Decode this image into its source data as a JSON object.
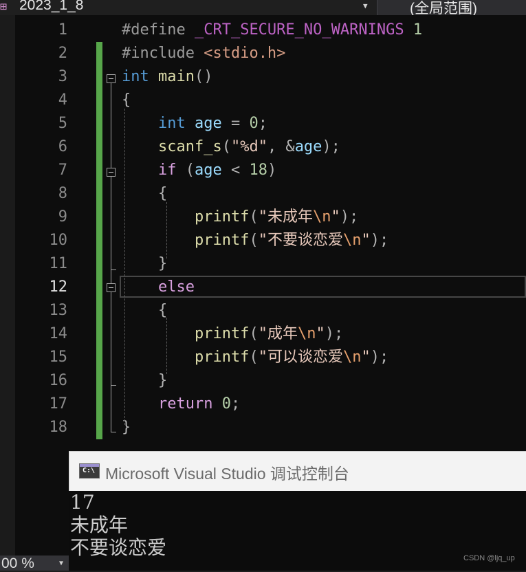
{
  "toolbar": {
    "project_name": "2023_1_8",
    "scope": "(全局范围)",
    "icons": {
      "project": "project-icon",
      "dropdown": "chevron-down-icon"
    }
  },
  "editor": {
    "line_numbers": [
      "1",
      "2",
      "3",
      "4",
      "5",
      "6",
      "7",
      "8",
      "9",
      "10",
      "11",
      "12",
      "13",
      "14",
      "15",
      "16",
      "17",
      "18"
    ],
    "current_line": "12",
    "lines": [
      [
        {
          "t": "#define ",
          "c": "pre"
        },
        {
          "t": "_CRT_SECURE_NO_WARNINGS",
          "c": "macro"
        },
        {
          "t": " ",
          "c": "op"
        },
        {
          "t": "1",
          "c": "num"
        }
      ],
      [
        {
          "t": "#include ",
          "c": "pre"
        },
        {
          "t": "<stdio.h>",
          "c": "inc"
        }
      ],
      [
        {
          "t": "int",
          "c": "kw"
        },
        {
          "t": " ",
          "c": "op"
        },
        {
          "t": "main",
          "c": "fn"
        },
        {
          "t": "()",
          "c": "op"
        }
      ],
      [
        {
          "t": "{",
          "c": "op"
        }
      ],
      [
        {
          "t": "    ",
          "c": "op"
        },
        {
          "t": "int",
          "c": "kw"
        },
        {
          "t": " ",
          "c": "op"
        },
        {
          "t": "age",
          "c": "var"
        },
        {
          "t": " = ",
          "c": "op"
        },
        {
          "t": "0",
          "c": "num"
        },
        {
          "t": ";",
          "c": "op"
        }
      ],
      [
        {
          "t": "    ",
          "c": "op"
        },
        {
          "t": "scanf_s",
          "c": "fn"
        },
        {
          "t": "(",
          "c": "op"
        },
        {
          "t": "\"%d\"",
          "c": "str"
        },
        {
          "t": ", &",
          "c": "op"
        },
        {
          "t": "age",
          "c": "var"
        },
        {
          "t": ");",
          "c": "op"
        }
      ],
      [
        {
          "t": "    ",
          "c": "op"
        },
        {
          "t": "if",
          "c": "ctrl"
        },
        {
          "t": " (",
          "c": "op"
        },
        {
          "t": "age",
          "c": "var"
        },
        {
          "t": " < ",
          "c": "op"
        },
        {
          "t": "18",
          "c": "num"
        },
        {
          "t": ")",
          "c": "op"
        }
      ],
      [
        {
          "t": "    {",
          "c": "op"
        }
      ],
      [
        {
          "t": "        ",
          "c": "op"
        },
        {
          "t": "printf",
          "c": "fn"
        },
        {
          "t": "(",
          "c": "op"
        },
        {
          "t": "\"未成年",
          "c": "str"
        },
        {
          "t": "\\n",
          "c": "esc"
        },
        {
          "t": "\"",
          "c": "str"
        },
        {
          "t": ");",
          "c": "op"
        }
      ],
      [
        {
          "t": "        ",
          "c": "op"
        },
        {
          "t": "printf",
          "c": "fn"
        },
        {
          "t": "(",
          "c": "op"
        },
        {
          "t": "\"不要谈恋爱",
          "c": "str"
        },
        {
          "t": "\\n",
          "c": "esc"
        },
        {
          "t": "\"",
          "c": "str"
        },
        {
          "t": ");",
          "c": "op"
        }
      ],
      [
        {
          "t": "    }",
          "c": "op"
        }
      ],
      [
        {
          "t": "    ",
          "c": "op"
        },
        {
          "t": "else",
          "c": "ctrl"
        }
      ],
      [
        {
          "t": "    {",
          "c": "op"
        }
      ],
      [
        {
          "t": "        ",
          "c": "op"
        },
        {
          "t": "printf",
          "c": "fn"
        },
        {
          "t": "(",
          "c": "op"
        },
        {
          "t": "\"成年",
          "c": "str"
        },
        {
          "t": "\\n",
          "c": "esc"
        },
        {
          "t": "\"",
          "c": "str"
        },
        {
          "t": ");",
          "c": "op"
        }
      ],
      [
        {
          "t": "        ",
          "c": "op"
        },
        {
          "t": "printf",
          "c": "fn"
        },
        {
          "t": "(",
          "c": "op"
        },
        {
          "t": "\"可以谈恋爱",
          "c": "str"
        },
        {
          "t": "\\n",
          "c": "esc"
        },
        {
          "t": "\"",
          "c": "str"
        },
        {
          "t": ");",
          "c": "op"
        }
      ],
      [
        {
          "t": "    }",
          "c": "op"
        }
      ],
      [
        {
          "t": "    ",
          "c": "op"
        },
        {
          "t": "return",
          "c": "ctrl"
        },
        {
          "t": " ",
          "c": "op"
        },
        {
          "t": "0",
          "c": "num"
        },
        {
          "t": ";",
          "c": "op"
        }
      ],
      [
        {
          "t": "}",
          "c": "op"
        }
      ]
    ],
    "colors": {
      "change_bar": "#57a64a",
      "keyword": "#569cd6",
      "control": "#d8a0df",
      "function": "#dcdcaa",
      "variable": "#9cdcfe",
      "string": "#e8c9bb",
      "number": "#b5cea8"
    }
  },
  "console": {
    "title": "Microsoft Visual Studio 调试控制台",
    "icon": "console-app-icon",
    "icon_text": "C:\\",
    "output": [
      "17",
      "未成年",
      "不要谈恋爱"
    ]
  },
  "status": {
    "zoom": "00 %"
  },
  "watermark": "CSDN @ljq_up"
}
